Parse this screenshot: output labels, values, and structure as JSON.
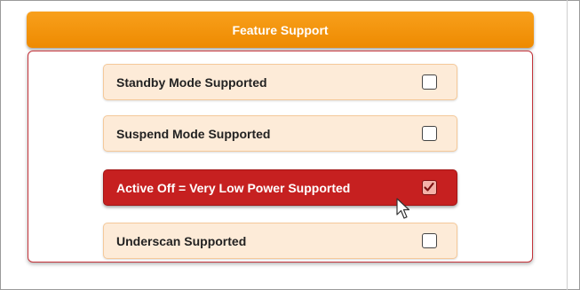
{
  "panel": {
    "title": "Feature Support",
    "rows": [
      {
        "label": "Standby Mode Supported",
        "checked": false
      },
      {
        "label": "Suspend Mode Supported",
        "checked": false
      },
      {
        "label": "Active Off = Very Low Power Supported",
        "checked": true
      },
      {
        "label": "Underscan Supported",
        "checked": false
      }
    ]
  },
  "colors": {
    "header": "#f39413",
    "active_row": "#c62020",
    "row_bg": "#fdebd8",
    "panel_border": "#c4333a"
  },
  "icons": {
    "check": "checkmark-icon",
    "cursor": "mouse-pointer-icon"
  }
}
